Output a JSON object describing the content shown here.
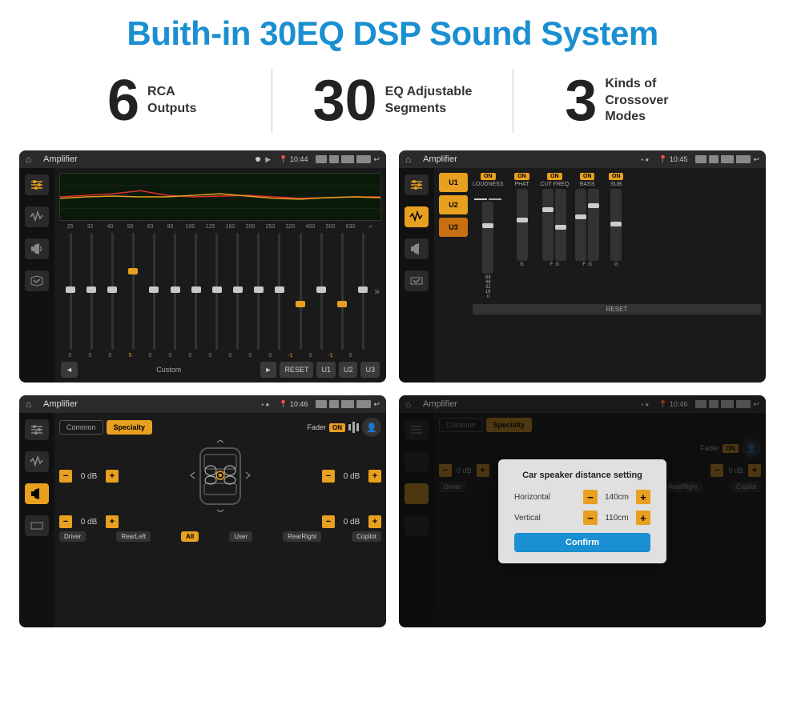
{
  "header": {
    "title": "Buith-in 30EQ DSP Sound System"
  },
  "stats": [
    {
      "number": "6",
      "label": "RCA\nOutputs"
    },
    {
      "number": "30",
      "label": "EQ Adjustable\nSegments"
    },
    {
      "number": "3",
      "label": "Kinds of\nCrossover Modes"
    }
  ],
  "screens": [
    {
      "id": "eq-screen",
      "status_title": "Amplifier",
      "status_time": "10:44",
      "type": "eq"
    },
    {
      "id": "crossover-screen",
      "status_title": "Amplifier",
      "status_time": "10:45",
      "type": "crossover"
    },
    {
      "id": "fader-screen",
      "status_title": "Amplifier",
      "status_time": "10:46",
      "type": "fader"
    },
    {
      "id": "dialog-screen",
      "status_title": "Amplifier",
      "status_time": "10:46",
      "type": "dialog"
    }
  ],
  "eq": {
    "frequencies": [
      "25",
      "32",
      "40",
      "50",
      "63",
      "80",
      "100",
      "125",
      "160",
      "200",
      "250",
      "320",
      "400",
      "500",
      "630"
    ],
    "values": [
      "0",
      "0",
      "0",
      "5",
      "0",
      "0",
      "0",
      "0",
      "0",
      "0",
      "0",
      "-1",
      "0",
      "-1",
      ""
    ],
    "thumb_positions": [
      50,
      50,
      50,
      30,
      50,
      50,
      50,
      50,
      50,
      50,
      50,
      60,
      50,
      60,
      50
    ],
    "preset": "Custom",
    "buttons": [
      "◄",
      "►",
      "RESET",
      "U1",
      "U2",
      "U3"
    ]
  },
  "crossover": {
    "presets": [
      "U1",
      "U2",
      "U3"
    ],
    "controls": [
      "LOUDNESS",
      "PHAT",
      "CUT FREQ",
      "BASS",
      "SUB"
    ],
    "all_on": true
  },
  "fader": {
    "tabs": [
      "Common",
      "Specialty"
    ],
    "active_tab": "Specialty",
    "fader_label": "Fader",
    "fader_on": "ON",
    "db_rows": [
      {
        "value": "0 dB"
      },
      {
        "value": "0 dB"
      },
      {
        "value": "0 dB"
      },
      {
        "value": "0 dB"
      }
    ],
    "bottom_btns": [
      "Driver",
      "RearLeft",
      "All",
      "User",
      "RearRight",
      "Copilot"
    ]
  },
  "dialog": {
    "title": "Car speaker distance setting",
    "rows": [
      {
        "label": "Horizontal",
        "value": "140cm"
      },
      {
        "label": "Vertical",
        "value": "110cm"
      }
    ],
    "confirm_label": "Confirm"
  }
}
